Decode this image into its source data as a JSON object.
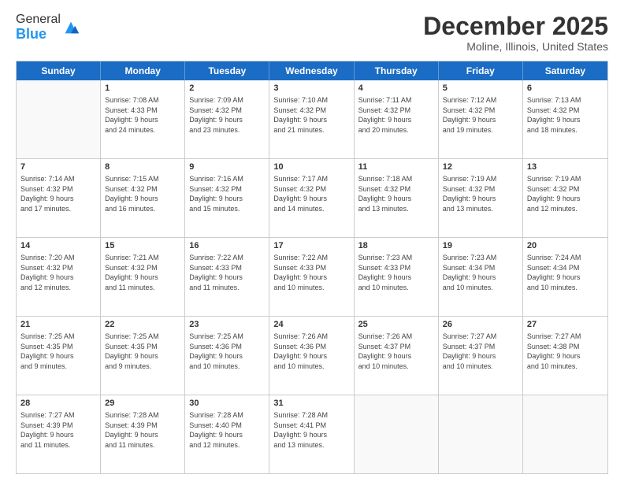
{
  "header": {
    "logo_general": "General",
    "logo_blue": "Blue",
    "title": "December 2025",
    "subtitle": "Moline, Illinois, United States"
  },
  "calendar": {
    "days_of_week": [
      "Sunday",
      "Monday",
      "Tuesday",
      "Wednesday",
      "Thursday",
      "Friday",
      "Saturday"
    ],
    "rows": [
      [
        {
          "day": "",
          "info": ""
        },
        {
          "day": "1",
          "info": "Sunrise: 7:08 AM\nSunset: 4:33 PM\nDaylight: 9 hours\nand 24 minutes."
        },
        {
          "day": "2",
          "info": "Sunrise: 7:09 AM\nSunset: 4:32 PM\nDaylight: 9 hours\nand 23 minutes."
        },
        {
          "day": "3",
          "info": "Sunrise: 7:10 AM\nSunset: 4:32 PM\nDaylight: 9 hours\nand 21 minutes."
        },
        {
          "day": "4",
          "info": "Sunrise: 7:11 AM\nSunset: 4:32 PM\nDaylight: 9 hours\nand 20 minutes."
        },
        {
          "day": "5",
          "info": "Sunrise: 7:12 AM\nSunset: 4:32 PM\nDaylight: 9 hours\nand 19 minutes."
        },
        {
          "day": "6",
          "info": "Sunrise: 7:13 AM\nSunset: 4:32 PM\nDaylight: 9 hours\nand 18 minutes."
        }
      ],
      [
        {
          "day": "7",
          "info": "Sunrise: 7:14 AM\nSunset: 4:32 PM\nDaylight: 9 hours\nand 17 minutes."
        },
        {
          "day": "8",
          "info": "Sunrise: 7:15 AM\nSunset: 4:32 PM\nDaylight: 9 hours\nand 16 minutes."
        },
        {
          "day": "9",
          "info": "Sunrise: 7:16 AM\nSunset: 4:32 PM\nDaylight: 9 hours\nand 15 minutes."
        },
        {
          "day": "10",
          "info": "Sunrise: 7:17 AM\nSunset: 4:32 PM\nDaylight: 9 hours\nand 14 minutes."
        },
        {
          "day": "11",
          "info": "Sunrise: 7:18 AM\nSunset: 4:32 PM\nDaylight: 9 hours\nand 13 minutes."
        },
        {
          "day": "12",
          "info": "Sunrise: 7:19 AM\nSunset: 4:32 PM\nDaylight: 9 hours\nand 13 minutes."
        },
        {
          "day": "13",
          "info": "Sunrise: 7:19 AM\nSunset: 4:32 PM\nDaylight: 9 hours\nand 12 minutes."
        }
      ],
      [
        {
          "day": "14",
          "info": "Sunrise: 7:20 AM\nSunset: 4:32 PM\nDaylight: 9 hours\nand 12 minutes."
        },
        {
          "day": "15",
          "info": "Sunrise: 7:21 AM\nSunset: 4:32 PM\nDaylight: 9 hours\nand 11 minutes."
        },
        {
          "day": "16",
          "info": "Sunrise: 7:22 AM\nSunset: 4:33 PM\nDaylight: 9 hours\nand 11 minutes."
        },
        {
          "day": "17",
          "info": "Sunrise: 7:22 AM\nSunset: 4:33 PM\nDaylight: 9 hours\nand 10 minutes."
        },
        {
          "day": "18",
          "info": "Sunrise: 7:23 AM\nSunset: 4:33 PM\nDaylight: 9 hours\nand 10 minutes."
        },
        {
          "day": "19",
          "info": "Sunrise: 7:23 AM\nSunset: 4:34 PM\nDaylight: 9 hours\nand 10 minutes."
        },
        {
          "day": "20",
          "info": "Sunrise: 7:24 AM\nSunset: 4:34 PM\nDaylight: 9 hours\nand 10 minutes."
        }
      ],
      [
        {
          "day": "21",
          "info": "Sunrise: 7:25 AM\nSunset: 4:35 PM\nDaylight: 9 hours\nand 9 minutes."
        },
        {
          "day": "22",
          "info": "Sunrise: 7:25 AM\nSunset: 4:35 PM\nDaylight: 9 hours\nand 9 minutes."
        },
        {
          "day": "23",
          "info": "Sunrise: 7:25 AM\nSunset: 4:36 PM\nDaylight: 9 hours\nand 10 minutes."
        },
        {
          "day": "24",
          "info": "Sunrise: 7:26 AM\nSunset: 4:36 PM\nDaylight: 9 hours\nand 10 minutes."
        },
        {
          "day": "25",
          "info": "Sunrise: 7:26 AM\nSunset: 4:37 PM\nDaylight: 9 hours\nand 10 minutes."
        },
        {
          "day": "26",
          "info": "Sunrise: 7:27 AM\nSunset: 4:37 PM\nDaylight: 9 hours\nand 10 minutes."
        },
        {
          "day": "27",
          "info": "Sunrise: 7:27 AM\nSunset: 4:38 PM\nDaylight: 9 hours\nand 10 minutes."
        }
      ],
      [
        {
          "day": "28",
          "info": "Sunrise: 7:27 AM\nSunset: 4:39 PM\nDaylight: 9 hours\nand 11 minutes."
        },
        {
          "day": "29",
          "info": "Sunrise: 7:28 AM\nSunset: 4:39 PM\nDaylight: 9 hours\nand 11 minutes."
        },
        {
          "day": "30",
          "info": "Sunrise: 7:28 AM\nSunset: 4:40 PM\nDaylight: 9 hours\nand 12 minutes."
        },
        {
          "day": "31",
          "info": "Sunrise: 7:28 AM\nSunset: 4:41 PM\nDaylight: 9 hours\nand 13 minutes."
        },
        {
          "day": "",
          "info": ""
        },
        {
          "day": "",
          "info": ""
        },
        {
          "day": "",
          "info": ""
        }
      ]
    ]
  }
}
